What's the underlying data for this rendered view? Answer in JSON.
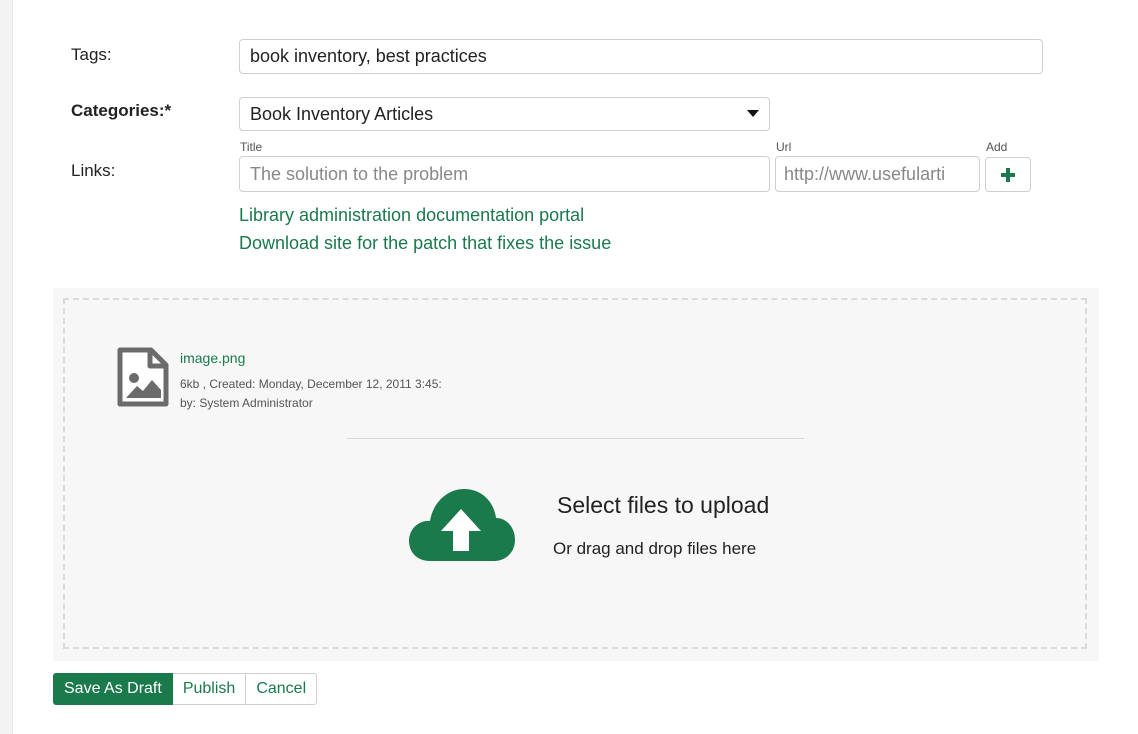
{
  "form": {
    "tags_label": "Tags:",
    "tags_value": "book inventory, best practices",
    "categories_label": "Categories:*",
    "categories_selected": "Book Inventory Articles",
    "links_label": "Links:",
    "link_title_label": "Title",
    "link_title_placeholder": "The solution to the problem",
    "link_url_label": "Url",
    "link_url_placeholder": "http://www.usefularti",
    "link_add_label": "Add",
    "links": [
      "Library administration documentation portal",
      "Download site for the patch that fixes the issue"
    ]
  },
  "attachments": {
    "file_name": "image.png",
    "file_meta_line1": "6kb , Created: Monday, December 12, 2011 3:45:",
    "file_meta_line2": "by: System Administrator",
    "upload_title": "Select files to upload",
    "upload_subtitle": "Or drag and drop files here"
  },
  "actions": {
    "save_draft": "Save As Draft",
    "publish": "Publish",
    "cancel": "Cancel"
  },
  "colors": {
    "accent": "#1a7a4c",
    "file_icon": "#6b6b6b",
    "dropzone_bg": "#f6f7f6"
  },
  "icons": {
    "add": "plus-icon",
    "file": "image-file-icon",
    "upload": "cloud-upload-icon",
    "dropdown": "caret-down-icon"
  }
}
